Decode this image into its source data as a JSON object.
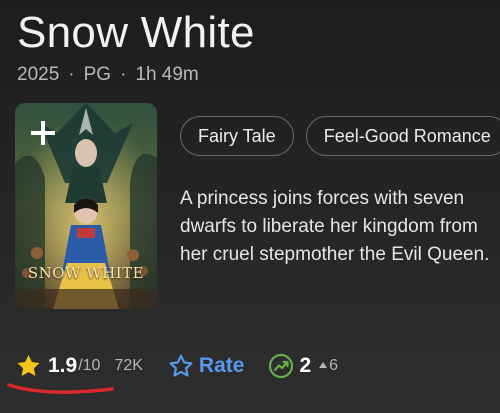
{
  "header": {
    "title": "Snow White",
    "year": "2025",
    "separator": "·",
    "rating": "PG",
    "runtime": "1h 49m"
  },
  "poster": {
    "add_icon": "plus-icon",
    "logo_text": "SNOW WHITE"
  },
  "genres": [
    "Fairy Tale",
    "Feel-Good Romance"
  ],
  "plot": {
    "lines": [
      "A princess joins forces with seven",
      "dwarfs to liberate her kingdom from",
      "her cruel stepmother the Evil Queen."
    ]
  },
  "ratings": {
    "score": "1.9",
    "out_of": "/10",
    "votes": "72K",
    "rate_label": "Rate",
    "popularity_rank": "2",
    "popularity_change": "6"
  },
  "colors": {
    "star": "#f5c518",
    "rate_blue": "#5799ef",
    "trend_green": "#67ad4b",
    "annotation_red": "#d8282b"
  }
}
